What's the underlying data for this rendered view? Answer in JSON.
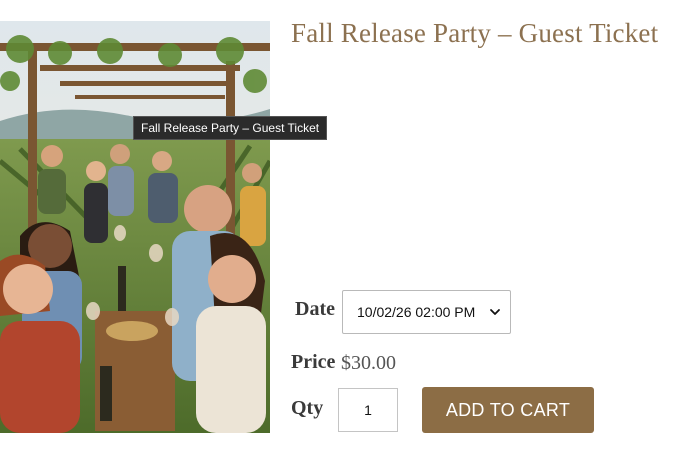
{
  "product": {
    "title": "Fall Release Party – Guest Ticket",
    "image_tooltip": "Fall Release Party – Guest Ticket"
  },
  "form": {
    "date_label": "Date",
    "date_value": "10/02/26 02:00 PM",
    "price_label": "Price",
    "price_value": "$30.00",
    "qty_label": "Qty",
    "qty_value": "1",
    "add_to_cart_label": "ADD TO CART"
  },
  "colors": {
    "accent": "#8c6d45",
    "title": "#8c7150"
  }
}
